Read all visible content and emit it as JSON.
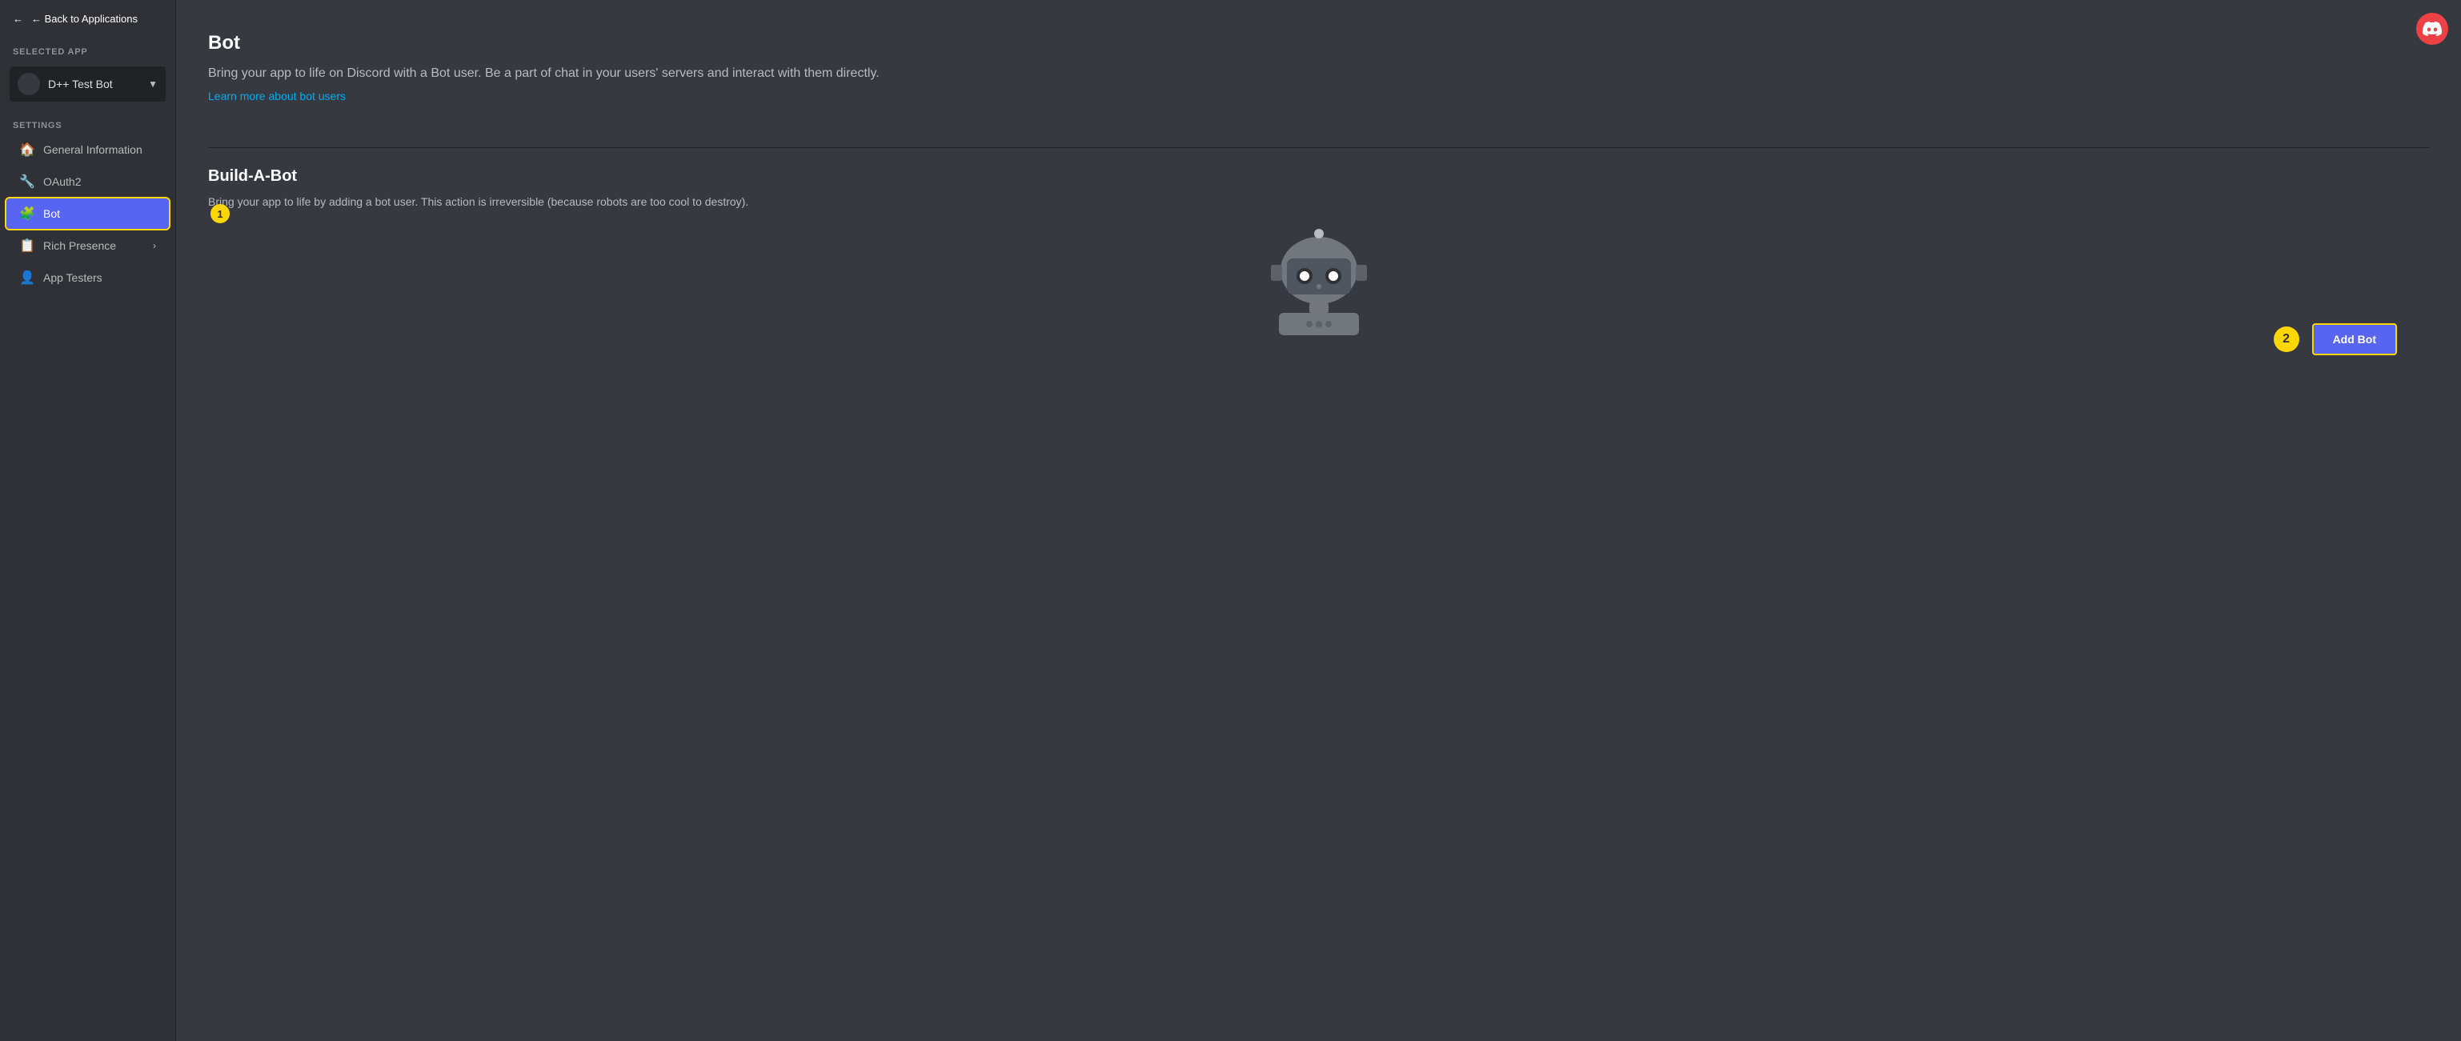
{
  "sidebar": {
    "back_label": "← Back to Applications",
    "selected_app_label": "SELECTED APP",
    "app_name": "D++ Test Bot",
    "settings_label": "SETTINGS",
    "nav_items": [
      {
        "id": "general-information",
        "icon": "🏠",
        "label": "General Information",
        "active": false,
        "has_chevron": false
      },
      {
        "id": "oauth2",
        "icon": "🔧",
        "label": "OAuth2",
        "active": false,
        "has_chevron": false
      },
      {
        "id": "bot",
        "icon": "🧩",
        "label": "Bot",
        "active": true,
        "has_chevron": false
      },
      {
        "id": "rich-presence",
        "icon": "📋",
        "label": "Rich Presence",
        "active": false,
        "has_chevron": true
      },
      {
        "id": "app-testers",
        "icon": "👤",
        "label": "App Testers",
        "active": false,
        "has_chevron": false
      }
    ],
    "badge_1": "1"
  },
  "main": {
    "title": "Bot",
    "description": "Bring your app to life on Discord with a Bot user. Be a part of chat in your users' servers and interact with them directly.",
    "learn_more": "Learn more about bot users",
    "build_a_bot": {
      "title": "Build-A-Bot",
      "description": "Bring your app to life by adding a bot user. This action is irreversible (because robots are too cool to destroy).",
      "add_bot_label": "Add Bot",
      "badge_2": "2"
    }
  },
  "discord_button": {
    "label": "Discord"
  }
}
